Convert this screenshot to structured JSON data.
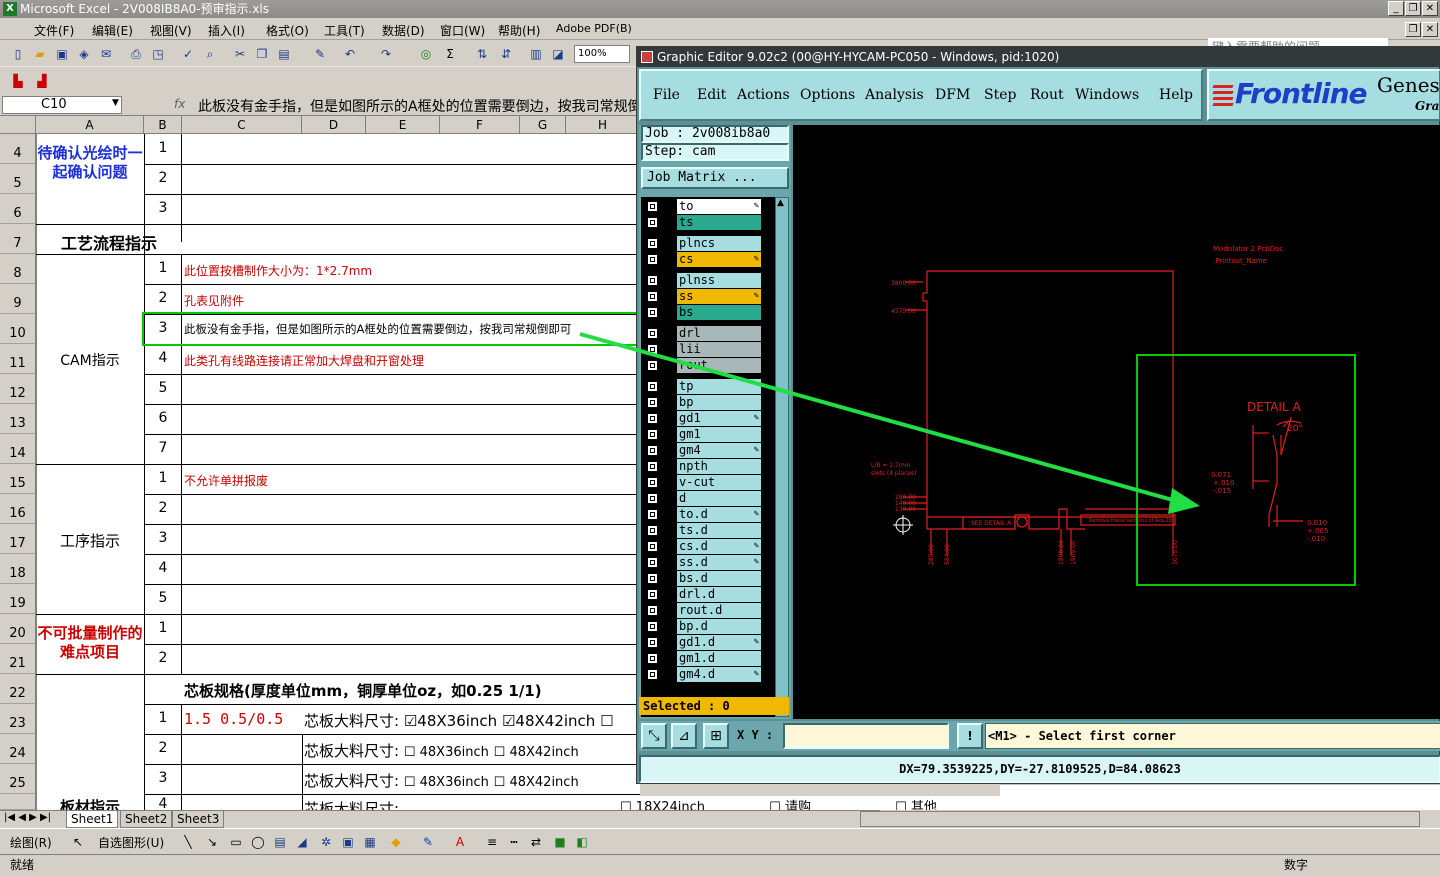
{
  "excel": {
    "title": "Microsoft Excel - 2V008IB8A0-预审指示.xls",
    "menu": [
      "文件(F)",
      "编辑(E)",
      "视图(V)",
      "插入(I)",
      "格式(O)",
      "工具(T)",
      "数据(D)",
      "窗口(W)",
      "帮助(H)",
      "Adobe PDF(B)"
    ],
    "help_placeholder": "键入需要帮助的问题",
    "zoom": "100%",
    "name_box": "C10",
    "fx": "fx",
    "formula": "此板没有金手指，但是如图所示的A框处的位置需要倒边，按我司常规倒即可",
    "columns": [
      "A",
      "B",
      "C",
      "D",
      "E",
      "F",
      "G",
      "H"
    ],
    "rows": [
      "4",
      "5",
      "6",
      "7",
      "8",
      "9",
      "10",
      "11",
      "12",
      "13",
      "14",
      "15",
      "16",
      "17",
      "18",
      "19",
      "20",
      "21",
      "22",
      "23",
      "24",
      "25"
    ],
    "sections": {
      "confirm": "待确认光绘时一起确认问题",
      "process": "工艺流程指示",
      "cam": "CAM指示",
      "procedure": "工序指示",
      "difficult": "不可批量制作的难点项目",
      "material": "板材指示"
    },
    "b_numbers": [
      "1",
      "2",
      "3",
      "",
      "1",
      "2",
      "3",
      "4",
      "5",
      "6",
      "7",
      "1",
      "2",
      "3",
      "4",
      "5",
      "1",
      "2",
      "",
      "1",
      "2",
      "3",
      "4"
    ],
    "cam_notes": [
      "此位置按槽制作大小为：1*2.7mm",
      "孔表见附件",
      "此板没有金手指，但是如图所示的A框处的位置需要倒边，按我司常规倒即可",
      "此类孔有线路连接请正常加大焊盘和开窗处理"
    ],
    "procedure_note": "不允许单拼报废",
    "core_header": "芯板规格(厚度单位mm，铜厚单位oz，如0.25 1/1)",
    "core_value": "1.5 0.5/0.5",
    "core_size_label": "芯板大料尺寸:",
    "size_a": "48X36inch",
    "size_b": "48X42inch",
    "size_c": "18X24inch",
    "extra1": "请购",
    "extra2": "其他",
    "sheets": [
      "Sheet1",
      "Sheet2",
      "Sheet3"
    ],
    "draw_label": "绘图(R)",
    "autoshape_label": "自选图形(U)",
    "status_left": "就绪",
    "status_right": "数字"
  },
  "editor": {
    "title": "Graphic Editor 9.02c2 (00@HY-HYCAM-PC050 - Windows, pid:1020)",
    "menu": [
      "File",
      "Edit",
      "Actions",
      "Options",
      "Analysis",
      "DFM",
      "Step",
      "Rout",
      "Windows",
      "Help"
    ],
    "logo": "Frontline",
    "logo_genesis": "Genes",
    "logo_graphic": "Graphi",
    "job": "Job : 2v008ib8a0",
    "step": "Step: cam",
    "job_matrix": "Job Matrix ...",
    "layers": [
      {
        "name": "to",
        "color": "#ffffff",
        "flag": true
      },
      {
        "name": "ts",
        "color": "#2aa98f",
        "flag": false
      },
      {
        "name": "plncs",
        "color": "#a6dde0",
        "flag": false
      },
      {
        "name": "cs",
        "color": "#f0b800",
        "flag": true
      },
      {
        "name": "plnss",
        "color": "#a6dde0",
        "flag": false
      },
      {
        "name": "ss",
        "color": "#f0b800",
        "flag": true
      },
      {
        "name": "bs",
        "color": "#2aa98f",
        "flag": false
      },
      {
        "name": "drl",
        "color": "#a8b8b8",
        "flag": false
      },
      {
        "name": "lii",
        "color": "#a8b8b8",
        "flag": false
      },
      {
        "name": "rout",
        "color": "#a8b8b8",
        "flag": false
      },
      {
        "name": "tp",
        "color": "#a6dde0",
        "flag": false
      },
      {
        "name": "bp",
        "color": "#a6dde0",
        "flag": false
      },
      {
        "name": "gd1",
        "color": "#a6dde0",
        "flag": true
      },
      {
        "name": "gm1",
        "color": "#a6dde0",
        "flag": false
      },
      {
        "name": "gm4",
        "color": "#a6dde0",
        "flag": true
      },
      {
        "name": "npth",
        "color": "#a6dde0",
        "flag": false
      },
      {
        "name": "v-cut",
        "color": "#a6dde0",
        "flag": false
      },
      {
        "name": "d",
        "color": "#a6dde0",
        "flag": false
      },
      {
        "name": "to.d",
        "color": "#a6dde0",
        "flag": true
      },
      {
        "name": "ts.d",
        "color": "#a6dde0",
        "flag": false
      },
      {
        "name": "cs.d",
        "color": "#a6dde0",
        "flag": true
      },
      {
        "name": "ss.d",
        "color": "#a6dde0",
        "flag": true
      },
      {
        "name": "bs.d",
        "color": "#a6dde0",
        "flag": false
      },
      {
        "name": "drl.d",
        "color": "#a6dde0",
        "flag": false
      },
      {
        "name": "rout.d",
        "color": "#a6dde0",
        "flag": false
      },
      {
        "name": "bp.d",
        "color": "#a6dde0",
        "flag": false
      },
      {
        "name": "gd1.d",
        "color": "#a6dde0",
        "flag": true
      },
      {
        "name": "gm1.d",
        "color": "#a6dde0",
        "flag": false
      },
      {
        "name": "gm4.d",
        "color": "#a6dde0",
        "flag": true
      }
    ],
    "selected": "Selected : 0",
    "xy_label": "X Y :",
    "prompt": "<M1> - Select first corner",
    "status": "DX=79.3539225,DY=-27.8109525,D=84.08623",
    "canvas": {
      "title_line1": "Modulator 2.PcbDoc",
      "title_line2": ".Printout_Name",
      "detail": "DETAIL A",
      "angle": "20°",
      "dim_a": "0.071",
      "dim_a_tol1": "+.010",
      "dim_a_tol2": "-.015",
      "dim_b": "0.010",
      "dim_b_tol1": "+.005",
      "dim_b_tol2": "-.010",
      "see_detail": "SEE DETAIL A",
      "remove_note": "Remove these sections of Rev.2b",
      "slot_note1": "L/B = 2.7mm",
      "slot_note2": "slots (4 places)",
      "ydim1": "3800.00",
      "ydim2": "4575.00",
      "ydim3": "280.00",
      "ydim4": "140.00",
      "ydim5": "130.00",
      "xdims": [
        "285.00",
        "584.00",
        "1800.00",
        "1905.00",
        "3075.00"
      ]
    },
    "colors": {
      "accent": "#00cc00",
      "pcb": "#e02020",
      "bg": "#000000",
      "panel": "#a6dde0"
    }
  }
}
